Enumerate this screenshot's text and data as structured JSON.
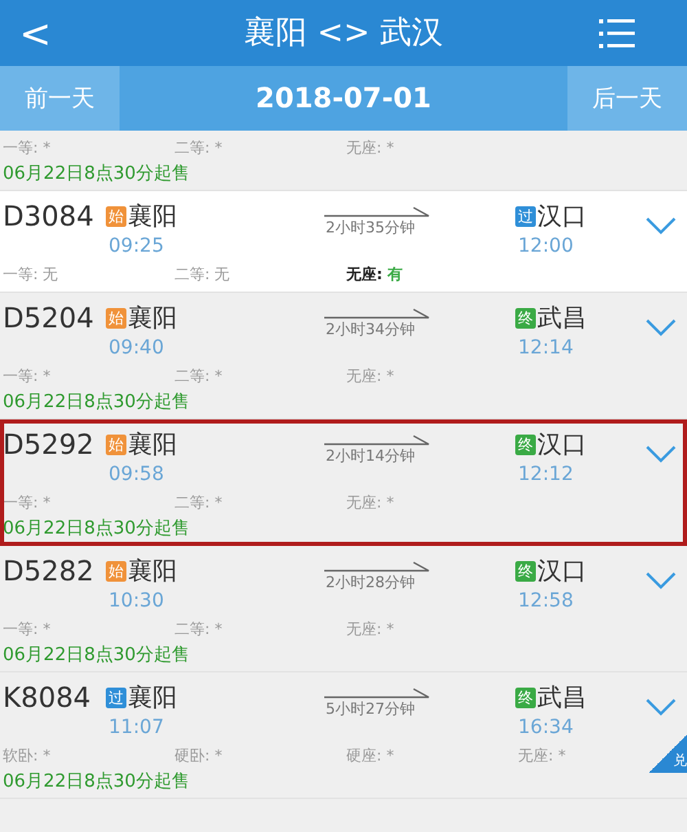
{
  "header": {
    "back": "<",
    "title": "襄阳 <> 武汉"
  },
  "date_bar": {
    "prev": "前一天",
    "date": "2018-07-01",
    "next": "后一天"
  },
  "trains": [
    {
      "highlighted": false,
      "available": false,
      "seats": [
        {
          "label": "一等:",
          "value": "*",
          "available": false
        },
        {
          "label": "二等:",
          "value": "*",
          "available": false
        },
        {
          "label": "无座:",
          "value": "*",
          "available": false
        }
      ],
      "sale_note": "06月22日8点30分起售"
    },
    {
      "number": "D3084",
      "highlighted": false,
      "available": true,
      "from": {
        "badge": "始",
        "kind": "start",
        "station": "襄阳",
        "time": "09:25"
      },
      "duration": "2小时35分钟",
      "to": {
        "badge": "过",
        "kind": "pass",
        "station": "汉口",
        "time": "12:00"
      },
      "seats": [
        {
          "label": "一等:",
          "value": "无",
          "available": false
        },
        {
          "label": "二等:",
          "value": "无",
          "available": false
        },
        {
          "label": "无座:",
          "value": "有",
          "available": true
        }
      ]
    },
    {
      "number": "D5204",
      "highlighted": false,
      "available": false,
      "from": {
        "badge": "始",
        "kind": "start",
        "station": "襄阳",
        "time": "09:40"
      },
      "duration": "2小时34分钟",
      "to": {
        "badge": "终",
        "kind": "end",
        "station": "武昌",
        "time": "12:14"
      },
      "seats": [
        {
          "label": "一等:",
          "value": "*",
          "available": false
        },
        {
          "label": "二等:",
          "value": "*",
          "available": false
        },
        {
          "label": "无座:",
          "value": "*",
          "available": false
        }
      ],
      "sale_note": "06月22日8点30分起售"
    },
    {
      "number": "D5292",
      "highlighted": true,
      "available": false,
      "from": {
        "badge": "始",
        "kind": "start",
        "station": "襄阳",
        "time": "09:58"
      },
      "duration": "2小时14分钟",
      "to": {
        "badge": "终",
        "kind": "end",
        "station": "汉口",
        "time": "12:12"
      },
      "seats": [
        {
          "label": "一等:",
          "value": "*",
          "available": false
        },
        {
          "label": "二等:",
          "value": "*",
          "available": false
        },
        {
          "label": "无座:",
          "value": "*",
          "available": false
        }
      ],
      "sale_note": "06月22日8点30分起售"
    },
    {
      "number": "D5282",
      "highlighted": false,
      "available": false,
      "from": {
        "badge": "始",
        "kind": "start",
        "station": "襄阳",
        "time": "10:30"
      },
      "duration": "2小时28分钟",
      "to": {
        "badge": "终",
        "kind": "end",
        "station": "汉口",
        "time": "12:58"
      },
      "seats": [
        {
          "label": "一等:",
          "value": "*",
          "available": false
        },
        {
          "label": "二等:",
          "value": "*",
          "available": false
        },
        {
          "label": "无座:",
          "value": "*",
          "available": false
        }
      ],
      "sale_note": "06月22日8点30分起售"
    },
    {
      "number": "K8084",
      "highlighted": false,
      "available": false,
      "from": {
        "badge": "过",
        "kind": "pass",
        "station": "襄阳",
        "time": "11:07"
      },
      "duration": "5小时27分钟",
      "to": {
        "badge": "终",
        "kind": "end",
        "station": "武昌",
        "time": "16:34"
      },
      "seats": [
        {
          "label": "软卧:",
          "value": "*",
          "available": false
        },
        {
          "label": "硬卧:",
          "value": "*",
          "available": false
        },
        {
          "label": "硬座:",
          "value": "*",
          "available": false
        },
        {
          "label": "无座:",
          "value": "*",
          "available": false
        }
      ],
      "sale_note": "06月22日8点30分起售",
      "corner_tag": "兑"
    }
  ]
}
